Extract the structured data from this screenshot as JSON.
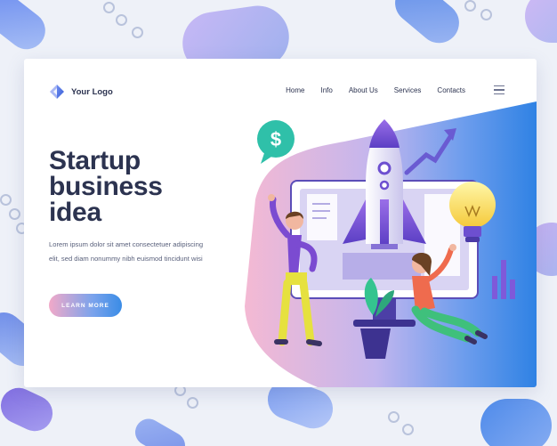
{
  "header": {
    "logo_text": "Your Logo",
    "nav": [
      "Home",
      "Info",
      "About Us",
      "Services",
      "Contacts"
    ]
  },
  "hero": {
    "title_lines": [
      "Startup",
      "business",
      "idea"
    ],
    "description": "Lorem ipsum dolor sit amet consectetuer adipiscing elit, sed diam nonummy nibh euismod tincidunt wisi",
    "cta_label": "LEARN MORE"
  },
  "illustration": {
    "coin_symbol": "$"
  },
  "colors": {
    "primary_text": "#2c3350",
    "accent_blue": "#3a8ce6",
    "accent_purple": "#7b57d9",
    "accent_pink": "#f2a9c8",
    "background": "#eef1f8"
  },
  "icons": [
    "logo-icon",
    "hamburger-menu-icon",
    "dollar-icon",
    "rocket-icon",
    "lightbulb-icon",
    "plant-icon",
    "arrow-up-icon"
  ]
}
